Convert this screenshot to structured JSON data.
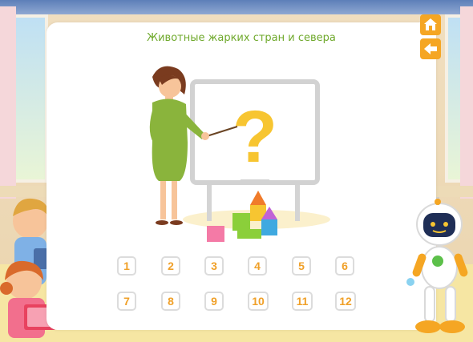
{
  "title": "Животные жарких стран и севера",
  "nav": {
    "home_icon": "home-icon",
    "back_icon": "arrow-left-icon"
  },
  "board": {
    "symbol": "?"
  },
  "numbers": [
    "1",
    "2",
    "3",
    "4",
    "5",
    "6",
    "7",
    "8",
    "9",
    "10",
    "11",
    "12"
  ],
  "colors": {
    "accent_orange": "#f5a623",
    "title_green": "#6fa92c",
    "number_orange": "#f0a028",
    "question_yellow": "#f7c531"
  }
}
